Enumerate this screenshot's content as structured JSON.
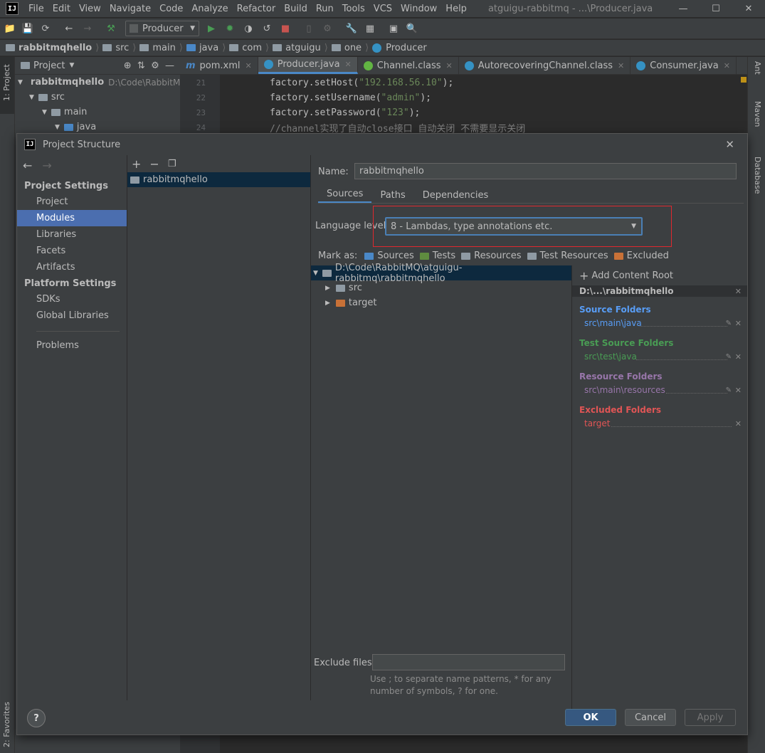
{
  "menubar": {
    "items": [
      "File",
      "Edit",
      "View",
      "Navigate",
      "Code",
      "Analyze",
      "Refactor",
      "Build",
      "Run",
      "Tools",
      "VCS",
      "Window",
      "Help"
    ],
    "window_title": "atguigu-rabbitmq - ...\\Producer.java"
  },
  "toolbar": {
    "run_config": "Producer"
  },
  "breadcrumb": [
    "rabbitmqhello",
    "src",
    "main",
    "java",
    "com",
    "atguigu",
    "one",
    "Producer"
  ],
  "left_strip": {
    "project": "1: Project",
    "favorites": "2: Favorites"
  },
  "right_strip": {
    "ant": "Ant",
    "maven": "Maven",
    "database": "Database"
  },
  "project_panel": {
    "header": "Project",
    "tree": [
      {
        "label": "rabbitmqhello",
        "path": "D:\\Code\\RabbitM"
      },
      {
        "label": "src"
      },
      {
        "label": "main"
      },
      {
        "label": "java"
      }
    ]
  },
  "editor": {
    "tabs": [
      "pom.xml",
      "Producer.java",
      "Channel.class",
      "AutorecoveringChannel.class",
      "Consumer.java"
    ],
    "lines": [
      {
        "num": "21",
        "pre": "factory.setHost(",
        "str": "\"192.168.56.10\"",
        "post": ");"
      },
      {
        "num": "22",
        "pre": "factory.setUsername(",
        "str": "\"admin\"",
        "post": ");"
      },
      {
        "num": "23",
        "pre": "factory.setPassword(",
        "str": "\"123\"",
        "post": ");"
      },
      {
        "num": "24",
        "comment": "//channel实现了自动close接口 自动关闭 不需要显示关闭"
      }
    ]
  },
  "dialog": {
    "title": "Project Structure",
    "sidebar": {
      "project_settings": "Project Settings",
      "items1": [
        "Project",
        "Modules",
        "Libraries",
        "Facets",
        "Artifacts"
      ],
      "platform_settings": "Platform Settings",
      "items2": [
        "SDKs",
        "Global Libraries"
      ],
      "problems": "Problems"
    },
    "module": "rabbitmqhello",
    "name_label": "Name:",
    "name_value": "rabbitmqhello",
    "tabs": [
      "Sources",
      "Paths",
      "Dependencies"
    ],
    "language_level_label": "Language level:",
    "language_level_value": "8 - Lambdas, type annotations etc.",
    "mark_as_label": "Mark as:",
    "mark_as": [
      "Sources",
      "Tests",
      "Resources",
      "Test Resources",
      "Excluded"
    ],
    "root_path": "D:\\Code\\RabbitMQ\\atguigu-rabbitmq\\rabbitmqhello",
    "tree_children": [
      "src",
      "target"
    ],
    "add_content_root": "Add Content Root",
    "content_root": "D:\\...\\rabbitmqhello",
    "source_folders": {
      "title": "Source Folders",
      "path": "src\\main\\java"
    },
    "test_source_folders": {
      "title": "Test Source Folders",
      "path": "src\\test\\java"
    },
    "resource_folders": {
      "title": "Resource Folders",
      "path": "src\\main\\resources"
    },
    "excluded_folders": {
      "title": "Excluded Folders",
      "path": "target"
    },
    "exclude_files_label": "Exclude files:",
    "exclude_hint": "Use ; to separate name patterns, * for any number of symbols, ? for one.",
    "buttons": {
      "ok": "OK",
      "cancel": "Cancel",
      "apply": "Apply",
      "help": "?"
    }
  },
  "colors": {
    "source": "#589df6",
    "test": "#499c54",
    "resource": "#9876aa",
    "excluded": "#e05555",
    "highlight": "#e0282e"
  }
}
